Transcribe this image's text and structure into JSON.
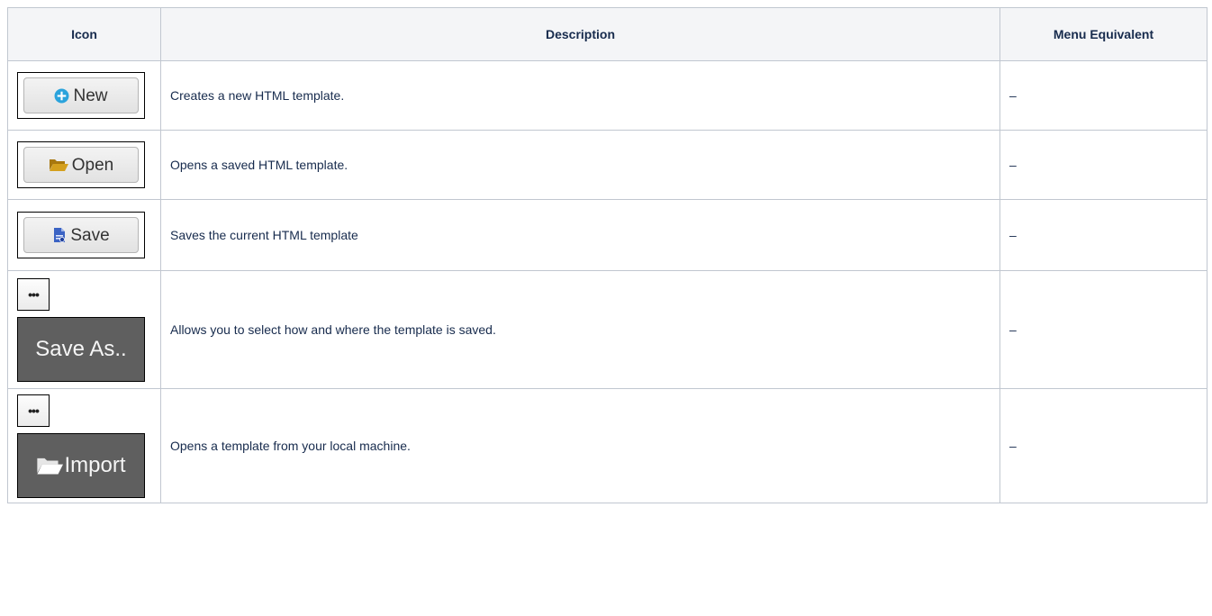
{
  "table": {
    "headers": {
      "icon": "Icon",
      "description": "Description",
      "menu": "Menu Equivalent"
    },
    "rows": [
      {
        "button_label": "New",
        "icon": "plus-circle-icon",
        "description": "Creates a new HTML template.",
        "menu": "–"
      },
      {
        "button_label": "Open",
        "icon": "folder-open-icon",
        "description": "Opens a saved HTML template.",
        "menu": "–"
      },
      {
        "button_label": "Save",
        "icon": "save-document-icon",
        "description": "Saves the current HTML template",
        "menu": "–"
      },
      {
        "ellipsis_label": "•••",
        "button_label": "Save As..",
        "description": "Allows you to select how and where the template is saved.",
        "menu": "–"
      },
      {
        "ellipsis_label": "•••",
        "button_label": "Import",
        "icon": "folder-open-icon",
        "description": "Opens a template from your local machine.",
        "menu": "–"
      }
    ]
  },
  "colors": {
    "new_icon": "#2aa3dc",
    "folder_icon": "#c79217",
    "save_icon": "#3b63c4",
    "dark_button_bg": "#5f5f5f"
  }
}
